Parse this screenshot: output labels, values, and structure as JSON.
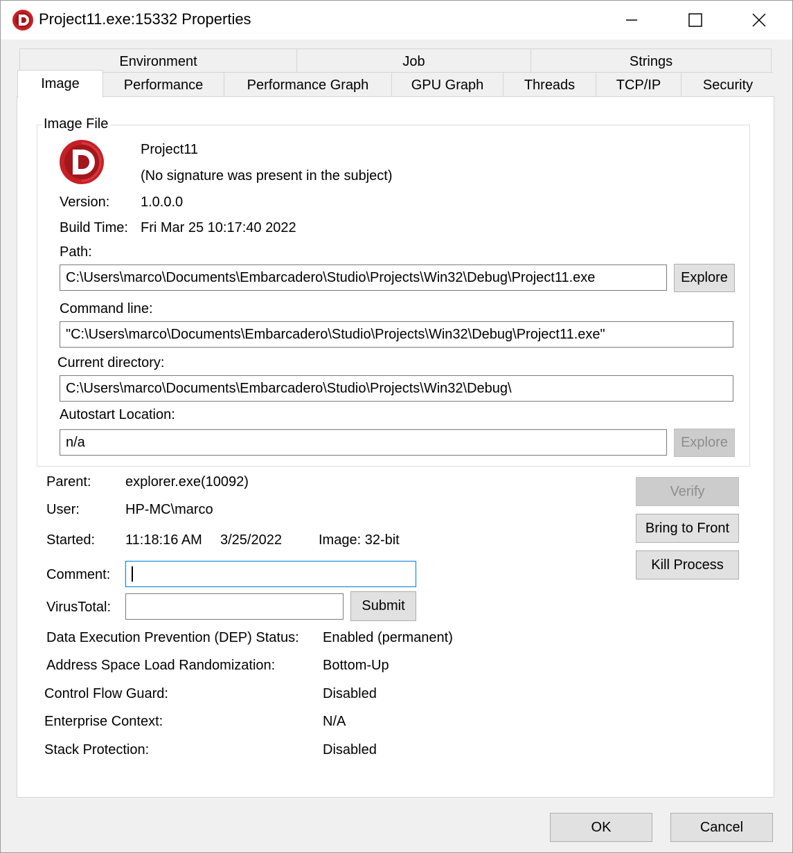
{
  "window": {
    "title": "Project11.exe:15332 Properties",
    "icon": "delphi-d-icon",
    "controls": {
      "minimize": "minimize-icon",
      "maximize": "maximize-icon",
      "close": "close-icon"
    }
  },
  "tabs": {
    "back_row": [
      "Environment",
      "Job",
      "Strings"
    ],
    "front_row": [
      "Image",
      "Performance",
      "Performance Graph",
      "GPU Graph",
      "Threads",
      "TCP/IP",
      "Security"
    ],
    "selected": "Image"
  },
  "image_file": {
    "group_label": "Image File",
    "name": "Project11",
    "signature": "(No signature was present in the subject)",
    "version_label": "Version:",
    "version": "1.0.0.0",
    "build_time_label": "Build Time:",
    "build_time": "Fri Mar 25 10:17:40 2022",
    "path_label": "Path:",
    "path": "C:\\Users\\marco\\Documents\\Embarcadero\\Studio\\Projects\\Win32\\Debug\\Project11.exe",
    "explore_label": "Explore",
    "command_line_label": "Command line:",
    "command_line": "\"C:\\Users\\marco\\Documents\\Embarcadero\\Studio\\Projects\\Win32\\Debug\\Project11.exe\"",
    "current_dir_label": "Current directory:",
    "current_dir": "C:\\Users\\marco\\Documents\\Embarcadero\\Studio\\Projects\\Win32\\Debug\\",
    "autostart_label": "Autostart Location:",
    "autostart": "n/a",
    "autostart_explore_label": "Explore"
  },
  "process": {
    "parent_label": "Parent:",
    "parent": "explorer.exe(10092)",
    "user_label": "User:",
    "user": "HP-MC\\marco",
    "started_label": "Started:",
    "started_time": "11:18:16 AM",
    "started_date": "3/25/2022",
    "image_bits": "Image: 32-bit",
    "comment_label": "Comment:",
    "comment_value": "",
    "virustotal_label": "VirusTotal:",
    "virustotal_value": "",
    "submit_label": "Submit",
    "verify_label": "Verify",
    "bring_to_front_label": "Bring to Front",
    "kill_process_label": "Kill Process"
  },
  "security": [
    {
      "label": "Data Execution Prevention (DEP) Status:",
      "value": "Enabled (permanent)"
    },
    {
      "label": "Address Space Load Randomization:",
      "value": "Bottom-Up"
    },
    {
      "label": "Control Flow Guard:",
      "value": "Disabled"
    },
    {
      "label": "Enterprise Context:",
      "value": "N/A"
    },
    {
      "label": "Stack Protection:",
      "value": "Disabled"
    }
  ],
  "footer": {
    "ok_label": "OK",
    "cancel_label": "Cancel"
  }
}
